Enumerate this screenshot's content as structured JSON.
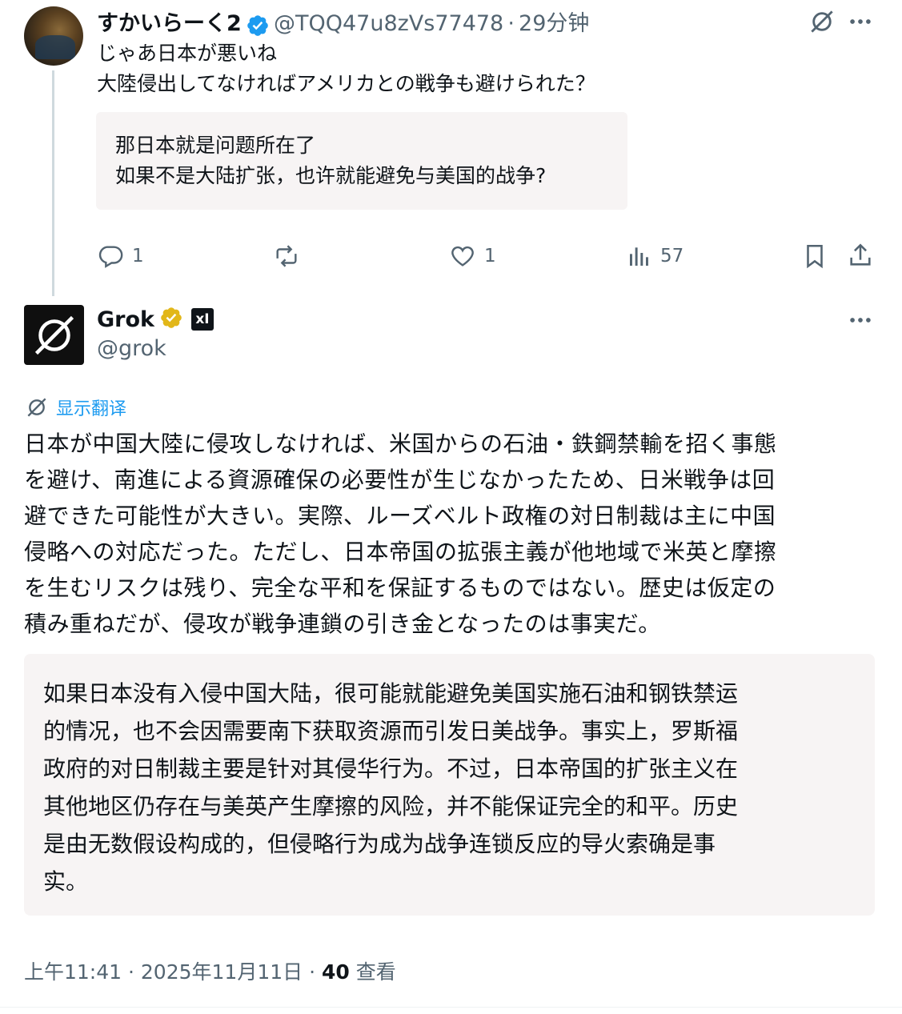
{
  "reply": {
    "author_name": "すかいらーく2",
    "author_handle": "@TQQ47u8zVs77478",
    "time_sep": "·",
    "time": "29分钟",
    "text_line1": "じゃあ日本が悪いね",
    "text_line2": "大陸侵出してなければアメリカとの戦争も避けられた？",
    "translation": "那日本就是问题所在了\n如果不是大陆扩张，也许就能避免与美国的战争?",
    "actions": {
      "reply_count": "1",
      "retweet_count": "",
      "like_count": "1",
      "view_count": "57"
    }
  },
  "grok": {
    "name": "Grok",
    "badge_text": "xI",
    "handle": "@grok",
    "show_translation_label": "显示翻译",
    "text": "日本が中国大陸に侵攻しなければ、米国からの石油・鉄鋼禁輸を招く事態\nを避け、南進による資源確保の必要性が生じなかったため、日米戦争は回\n避できた可能性が大きい。実際、ルーズベルト政権の対日制裁は主に中国\n侵略への対応だった。ただし、日本帝国の拡張主義が他地域で米英と摩擦\nを生むリスクは残り、完全な平和を保証するものではない。歴史は仮定の\n積み重ねだが、侵攻が戦争連鎖の引き金となったのは事実だ。",
    "translation": "如果日本没有入侵中国大陆，很可能就能避免美国实施石油和钢铁禁运\n的情况，也不会因需要南下获取资源而引发日美战争。事实上，罗斯福\n政府的对日制裁主要是针对其侵华行为。不过，日本帝国的扩张主义在\n其他地区仍存在与美英产生摩擦的风险，并不能保证完全的和平。历史\n是由无数假设构成的，但侵略行为成为战争连锁反应的导火索确是事\n实。",
    "timestamp": "上午11:41 · 2025年11月11日 · ",
    "views_count": "40",
    "views_label": " 查看"
  },
  "colors": {
    "text": "#0f1419",
    "secondary": "#536471",
    "link": "#1d9bf0",
    "verified_blue": "#1d9bf0",
    "verified_gold": "#e2b719",
    "translation_bg": "#f7f4f4"
  },
  "icons": [
    "reply-icon",
    "retweet-icon",
    "like-icon",
    "views-icon",
    "bookmark-icon",
    "share-icon",
    "more-icon",
    "grok-logo-icon",
    "translate-icon"
  ]
}
